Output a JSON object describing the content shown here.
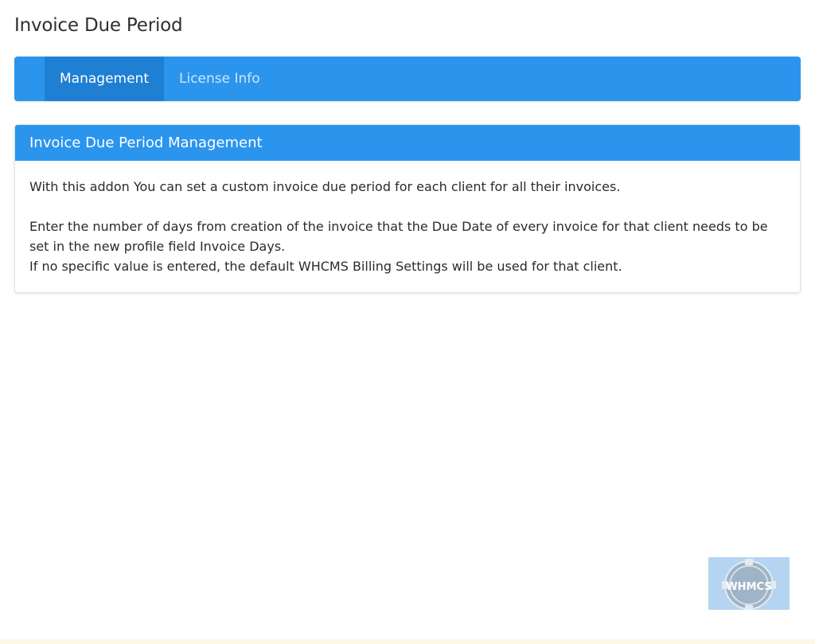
{
  "page": {
    "title": "Invoice Due Period"
  },
  "nav": {
    "tabs": [
      {
        "label": "Management",
        "active": true
      },
      {
        "label": "License Info",
        "active": false
      }
    ]
  },
  "panel": {
    "heading": "Invoice Due Period Management",
    "paragraph_1": "With this addon You can set a custom invoice due period for each client for all their invoices.",
    "paragraph_2": "Enter the number of days from creation of the invoice that the Due Date of every invoice for that client needs to be set in the new profile field Invoice Days.",
    "paragraph_3": "If no specific value is entered, the default WHCMS Billing Settings will be used for that client."
  },
  "watermark": {
    "text": "WHMCS",
    "icon": "whmcs-badge-icon"
  },
  "colors": {
    "accent": "#2b95ee",
    "active_tab": "#1f7fd3"
  }
}
